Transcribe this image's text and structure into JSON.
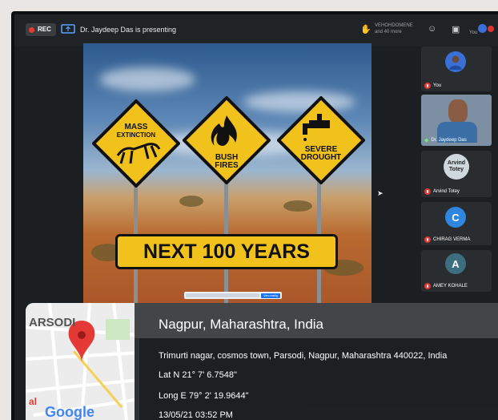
{
  "meeting": {
    "rec_label": "REC",
    "presenter_text": "Dr. Jaydeep Das is presenting",
    "participants_summary": "VEHOHDOMENE and 40 more",
    "you_label": "You"
  },
  "slide": {
    "sign_left": [
      "MASS",
      "EXTINCTION"
    ],
    "sign_mid": [
      "BUSH",
      "FIRES"
    ],
    "sign_right": [
      "SEVERE",
      "DROUGHT"
    ],
    "banner": "NEXT 100 YEARS",
    "search_button": "Vero marlig"
  },
  "participants": [
    {
      "name": "You",
      "initial": "",
      "color": "#3b6fd8"
    },
    {
      "name": "Dr. Jaydeep Das",
      "initial": "",
      "color": "#3a6ea5"
    },
    {
      "name": "Arvind Totey",
      "initial": "Arvind Totey",
      "color": "#cfd8dc"
    },
    {
      "name": "CHIRAG VERMA",
      "initial": "C",
      "color": "#2e86de"
    },
    {
      "name": "AMEY KOHALE",
      "initial": "A",
      "color": "#3c6e80"
    }
  ],
  "location": {
    "map_label_top": "ARSODI",
    "map_logo_prefix": "al",
    "map_logo": "Google",
    "place": "Nagpur, Maharashtra, India",
    "address": "Trimurti nagar, cosmos town, Parsodi, Nagpur, Maharashtra 440022, India",
    "lat": "Lat N 21° 7' 6.7548\"",
    "long": "Long E 79° 2' 19.9644\"",
    "timestamp": "13/05/21 03:52 PM"
  },
  "colors": {
    "rec_dot": "#e53935",
    "sign_yellow": "#f2c21c",
    "map_pin": "#e53935"
  }
}
